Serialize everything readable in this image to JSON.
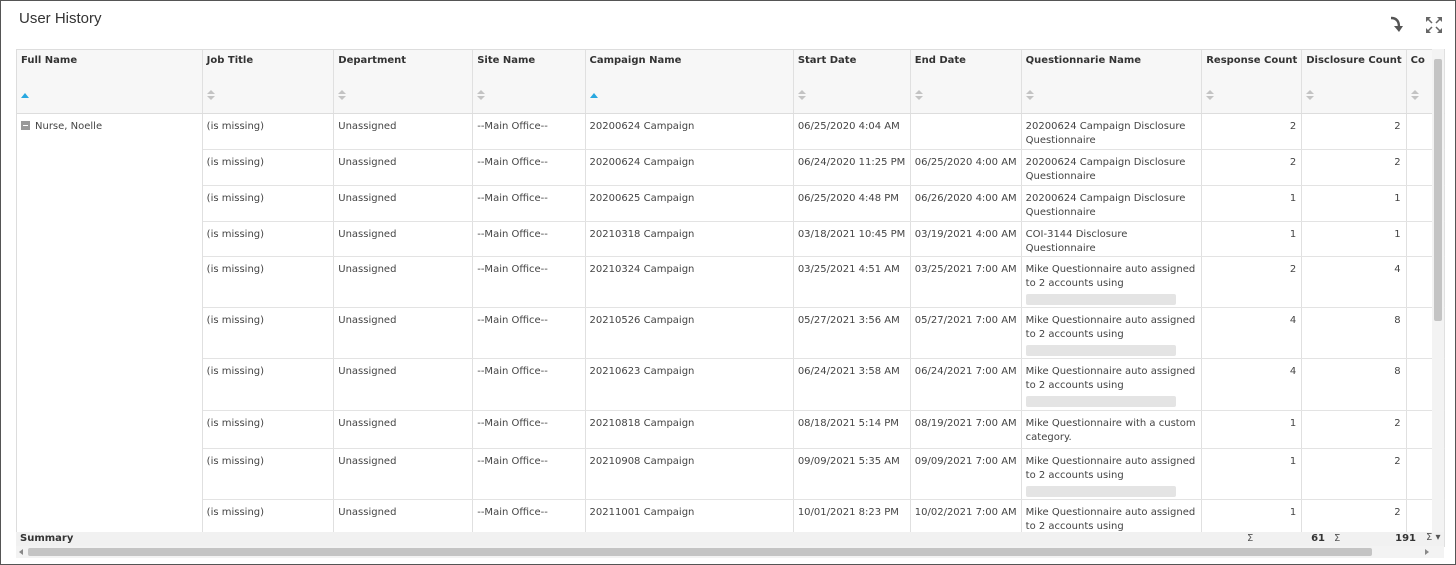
{
  "widget": {
    "title": "User History"
  },
  "toolbar": {
    "export_icon": "export-arrow-icon",
    "expand_icon": "expand-icon"
  },
  "columns": [
    {
      "label": "Full Name",
      "sort": "asc"
    },
    {
      "label": "Job Title",
      "sort": "none"
    },
    {
      "label": "Department",
      "sort": "none"
    },
    {
      "label": "Site Name",
      "sort": "none"
    },
    {
      "label": "Campaign Name",
      "sort": "asc"
    },
    {
      "label": "Start Date",
      "sort": "none"
    },
    {
      "label": "End Date",
      "sort": "none"
    },
    {
      "label": "Questionnarie Name",
      "sort": "none"
    },
    {
      "label": "Response Count",
      "sort": "none"
    },
    {
      "label": "Disclosure Count",
      "sort": "none"
    },
    {
      "label": "Co",
      "sort": "none"
    }
  ],
  "group": {
    "full_name": "Nurse, Noelle"
  },
  "rows": [
    {
      "job_title": "(is missing)",
      "department": "Unassigned",
      "site": "--Main Office--",
      "campaign": "20200624 Campaign",
      "start": "06/25/2020 4:04 AM",
      "end": "",
      "questionnaire": "20200624 Campaign Disclosure Questionnaire",
      "responses": "2",
      "disclosures": "2",
      "redacted": false
    },
    {
      "job_title": "(is missing)",
      "department": "Unassigned",
      "site": "--Main Office--",
      "campaign": "20200624 Campaign",
      "start": "06/24/2020 11:25 PM",
      "end": "06/25/2020 4:00 AM",
      "questionnaire": "20200624 Campaign Disclosure Questionnaire",
      "responses": "2",
      "disclosures": "2",
      "redacted": false
    },
    {
      "job_title": "(is missing)",
      "department": "Unassigned",
      "site": "--Main Office--",
      "campaign": "20200625 Campaign",
      "start": "06/25/2020 4:48 PM",
      "end": "06/26/2020 4:00 AM",
      "questionnaire": "20200624 Campaign Disclosure Questionnaire",
      "responses": "1",
      "disclosures": "1",
      "redacted": false
    },
    {
      "job_title": "(is missing)",
      "department": "Unassigned",
      "site": "--Main Office--",
      "campaign": "20210318 Campaign",
      "start": "03/18/2021 10:45 PM",
      "end": "03/19/2021 4:00 AM",
      "questionnaire": "COI-3144 Disclosure Questionnaire",
      "responses": "1",
      "disclosures": "1",
      "redacted": false
    },
    {
      "job_title": "(is missing)",
      "department": "Unassigned",
      "site": "--Main Office--",
      "campaign": "20210324 Campaign",
      "start": "03/25/2021 4:51 AM",
      "end": "03/25/2021 7:00 AM",
      "questionnaire": "Mike Questionnaire auto assigned to 2 accounts using",
      "responses": "2",
      "disclosures": "4",
      "redacted": true
    },
    {
      "job_title": "(is missing)",
      "department": "Unassigned",
      "site": "--Main Office--",
      "campaign": "20210526 Campaign",
      "start": "05/27/2021 3:56 AM",
      "end": "05/27/2021 7:00 AM",
      "questionnaire": "Mike Questionnaire auto assigned to 2 accounts using",
      "responses": "4",
      "disclosures": "8",
      "redacted": true
    },
    {
      "job_title": "(is missing)",
      "department": "Unassigned",
      "site": "--Main Office--",
      "campaign": "20210623 Campaign",
      "start": "06/24/2021 3:58 AM",
      "end": "06/24/2021 7:00 AM",
      "questionnaire": "Mike Questionnaire auto assigned to 2 accounts using",
      "responses": "4",
      "disclosures": "8",
      "redacted": true
    },
    {
      "job_title": "(is missing)",
      "department": "Unassigned",
      "site": "--Main Office--",
      "campaign": "20210818 Campaign",
      "start": "08/18/2021 5:14 PM",
      "end": "08/19/2021 7:00 AM",
      "questionnaire": "Mike Questionnaire with a custom category.",
      "responses": "1",
      "disclosures": "2",
      "redacted": false
    },
    {
      "job_title": "(is missing)",
      "department": "Unassigned",
      "site": "--Main Office--",
      "campaign": "20210908 Campaign",
      "start": "09/09/2021 5:35 AM",
      "end": "09/09/2021 7:00 AM",
      "questionnaire": "Mike Questionnaire auto assigned to 2 accounts using",
      "responses": "1",
      "disclosures": "2",
      "redacted": true
    },
    {
      "job_title": "(is missing)",
      "department": "Unassigned",
      "site": "--Main Office--",
      "campaign": "20211001 Campaign",
      "start": "10/01/2021 8:23 PM",
      "end": "10/02/2021 7:00 AM",
      "questionnaire": "Mike Questionnaire auto assigned to 2 accounts using",
      "responses": "1",
      "disclosures": "2",
      "redacted": true
    }
  ],
  "summary": {
    "label": "Summary",
    "sigma": "Σ",
    "response_total": "61",
    "disclosure_total": "191",
    "more": "Σ ▾"
  }
}
